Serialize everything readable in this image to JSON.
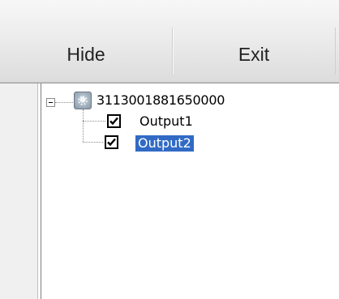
{
  "toolbar": {
    "hide_label": "Hide",
    "exit_label": "Exit"
  },
  "tree": {
    "root": {
      "label": "3113001881650000",
      "expanded": true,
      "icon": "device-icon"
    },
    "children": [
      {
        "label": "Output1",
        "checked": true,
        "selected": false
      },
      {
        "label": "Output2",
        "checked": true,
        "selected": true
      }
    ]
  },
  "colors": {
    "selection": "#316ac5",
    "selection_text": "#ffffff"
  }
}
